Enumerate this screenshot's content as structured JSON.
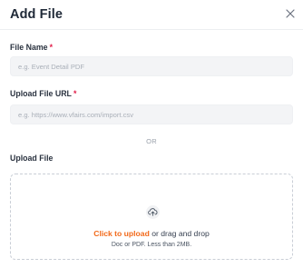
{
  "dialog": {
    "title": "Add File",
    "close_icon": "close-icon"
  },
  "fields": {
    "file_name": {
      "label": "File Name",
      "required_marker": "*",
      "placeholder": "e.g. Event Detail PDF",
      "value": ""
    },
    "file_url": {
      "label": "Upload File URL",
      "required_marker": "*",
      "placeholder": "e.g. https://www.vfairs.com/import.csv",
      "value": ""
    }
  },
  "separator": {
    "text": "OR"
  },
  "upload": {
    "label": "Upload File",
    "icon": "cloud-upload-icon",
    "link_text": "Click to upload",
    "rest_text": " or drag and drop",
    "hint": "Doc or PDF. Less than 2MB."
  },
  "colors": {
    "accent": "#f26a1b",
    "required": "#e11d48",
    "input_bg": "#f3f4f6"
  }
}
